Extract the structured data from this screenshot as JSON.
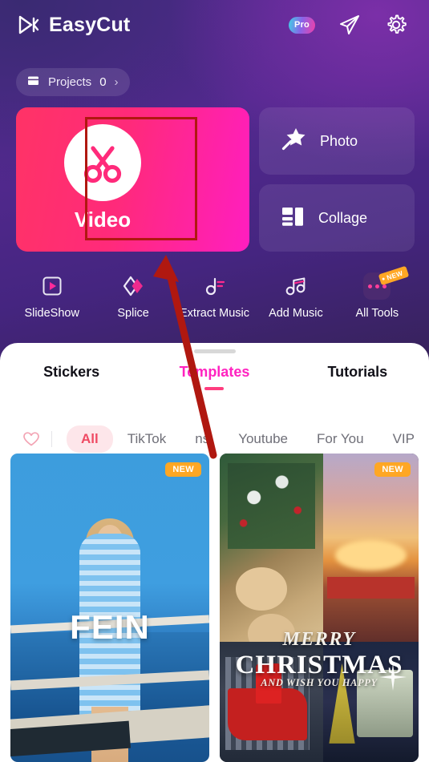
{
  "header": {
    "app_name": "EasyCut",
    "logo_icon": "easycut-logo-icon",
    "pro_label": "Pro",
    "share_icon": "send-plane-icon",
    "settings_icon": "gear-icon"
  },
  "projects": {
    "icon": "folder-icon",
    "label": "Projects",
    "count": "0",
    "chevron": "›"
  },
  "cards": {
    "video": {
      "label": "Video",
      "icon": "scissors-icon"
    },
    "photo": {
      "label": "Photo",
      "icon": "magic-wand-star-icon"
    },
    "collage": {
      "label": "Collage",
      "icon": "collage-grid-icon"
    }
  },
  "tools": [
    {
      "label": "SlideShow",
      "icon": "slideshow-play-icon"
    },
    {
      "label": "Splice",
      "icon": "splice-diamond-icon"
    },
    {
      "label": "Extract Music",
      "icon": "extract-music-note-icon"
    },
    {
      "label": "Add Music",
      "icon": "add-music-note-icon"
    },
    {
      "label": "All Tools",
      "icon": "more-dots-icon",
      "badge": "NEW"
    }
  ],
  "sheet": {
    "tabs": [
      {
        "label": "Stickers",
        "active": false
      },
      {
        "label": "Templates",
        "active": true
      },
      {
        "label": "Tutorials",
        "active": false
      }
    ],
    "chips": [
      {
        "label": "All",
        "selected": true
      },
      {
        "label": "TikTok",
        "selected": false
      },
      {
        "label": "ns",
        "selected": false
      },
      {
        "label": "Youtube",
        "selected": false
      },
      {
        "label": "For You",
        "selected": false
      },
      {
        "label": "VIP",
        "selected": false
      }
    ],
    "favorite_icon": "heart-outline-icon"
  },
  "templates": [
    {
      "badge": "NEW",
      "overlay_text": "FEIN",
      "description": "woman-in-blue-striped-outfit-by-the-sea"
    },
    {
      "badge": "NEW",
      "line1": "MERRY",
      "line2": "CHRISTMAS",
      "line3": "AND WISH YOU HAPPY",
      "description": "christmas-collage-with-santa-sleigh"
    }
  ],
  "annotation": {
    "highlight_target": "video-card",
    "arrow_color": "#b01810",
    "box_color": "#b01810"
  },
  "colors": {
    "accent_pink": "#ff23c0",
    "tab_underline": "#ff3d7f",
    "badge_orange": "#ffa724",
    "chip_selected_bg": "#fde6ea",
    "chip_selected_text": "#ef4a63",
    "sheet_bg": "#ffffff"
  }
}
